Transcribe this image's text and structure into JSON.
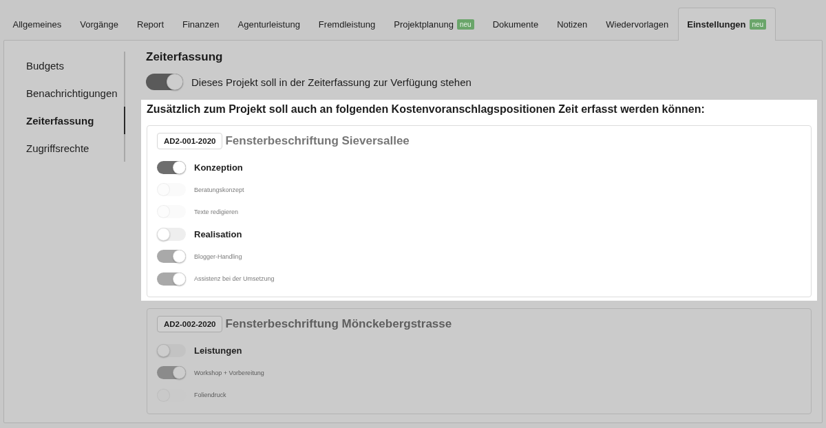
{
  "tabs": [
    {
      "label": "Allgemeines",
      "selected": false
    },
    {
      "label": "Vorgänge",
      "selected": false
    },
    {
      "label": "Report",
      "selected": false
    },
    {
      "label": "Finanzen",
      "selected": false
    },
    {
      "label": "Agenturleistung",
      "selected": false
    },
    {
      "label": "Fremdleistung",
      "selected": false
    },
    {
      "label": "Projektplanung",
      "badge": "neu",
      "selected": false
    },
    {
      "label": "Dokumente",
      "selected": false
    },
    {
      "label": "Notizen",
      "selected": false
    },
    {
      "label": "Wiedervorlagen",
      "selected": false
    },
    {
      "label": "Einstellungen",
      "badge": "neu",
      "selected": true
    }
  ],
  "sidebar": {
    "items": [
      {
        "label": "Budgets",
        "selected": false
      },
      {
        "label": "Benachrichtigungen",
        "selected": false
      },
      {
        "label": "Zeiterfassung",
        "selected": true
      },
      {
        "label": "Zugriffsrechte",
        "selected": false
      }
    ]
  },
  "section": {
    "title": "Zeiterfassung",
    "master_toggle": {
      "label": "Dieses Projekt soll in der Zeiterfassung zur Verfügung stehen",
      "on": true,
      "disabled": false
    }
  },
  "spotlight": {
    "heading": "Zusätzlich zum Projekt soll auch an folgenden Kostenvoranschlagspositionen Zeit erfasst werden können:",
    "cards": [
      {
        "number": "AD2-001-2020",
        "title": "Fensterbeschriftung Sieversallee",
        "rows": [
          {
            "kind": "group",
            "label": "Konzeption",
            "on": true,
            "disabled": false
          },
          {
            "kind": "item",
            "label": "Beratungskonzept",
            "on": false,
            "disabled": true
          },
          {
            "kind": "item",
            "label": "Texte redigieren",
            "on": false,
            "disabled": true
          },
          {
            "kind": "group",
            "label": "Realisation",
            "on": false,
            "disabled": false
          },
          {
            "kind": "item",
            "label": "Blogger-Handling",
            "on": true,
            "disabled": true
          },
          {
            "kind": "item",
            "label": "Assistenz bei der Umsetzung",
            "on": true,
            "disabled": true
          }
        ]
      }
    ]
  },
  "cards": [
    {
      "number": "AD2-002-2020",
      "title": "Fensterbeschriftung Mönckebergstrasse",
      "rows": [
        {
          "kind": "group",
          "label": "Leistungen",
          "on": false,
          "disabled": false
        },
        {
          "kind": "item",
          "label": "Workshop + Vorbereitung",
          "on": true,
          "disabled": true
        },
        {
          "kind": "item",
          "label": "Foliendruck",
          "on": false,
          "disabled": true
        }
      ]
    }
  ]
}
